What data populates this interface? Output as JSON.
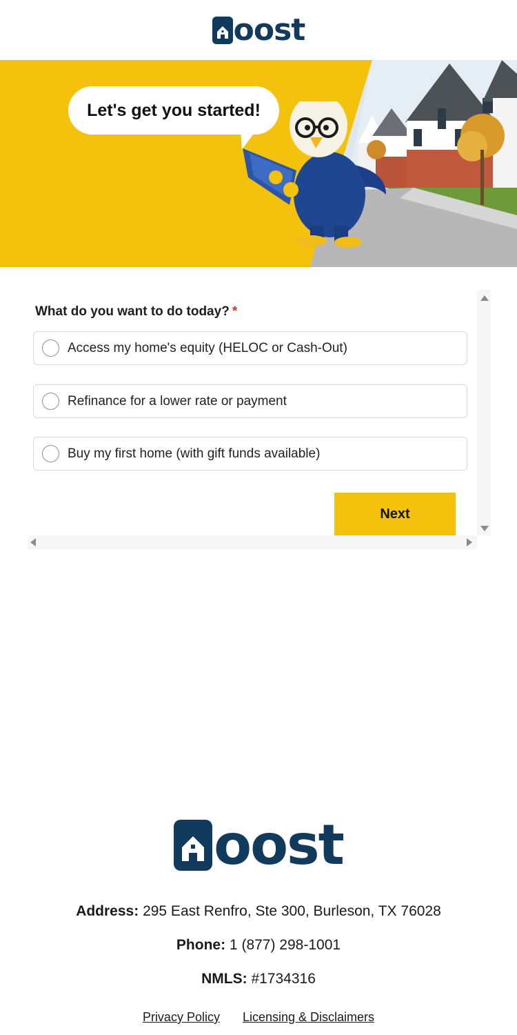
{
  "brand": {
    "name": "Roost",
    "word_suffix": "oost",
    "color": "#123a5c",
    "accent": "#f4c20d"
  },
  "hero": {
    "bubble_text": "Let's get you started!"
  },
  "form": {
    "question": "What do you want to do today?",
    "required_mark": "*",
    "options": [
      {
        "label": "Access my home's equity (HELOC or Cash-Out)",
        "selected": false
      },
      {
        "label": "Refinance for a lower rate or payment",
        "selected": false
      },
      {
        "label": "Buy my first home (with gift funds available)",
        "selected": false
      }
    ],
    "next_label": "Next"
  },
  "footer": {
    "address_label": "Address:",
    "address_value": "295 East Renfro, Ste 300, Burleson, TX 76028",
    "phone_label": "Phone:",
    "phone_value": "1 (877) 298-1001",
    "nmls_label": "NMLS:",
    "nmls_value": "#1734316",
    "links": {
      "privacy": "Privacy Policy",
      "licensing": "Licensing & Disclaimers"
    }
  }
}
